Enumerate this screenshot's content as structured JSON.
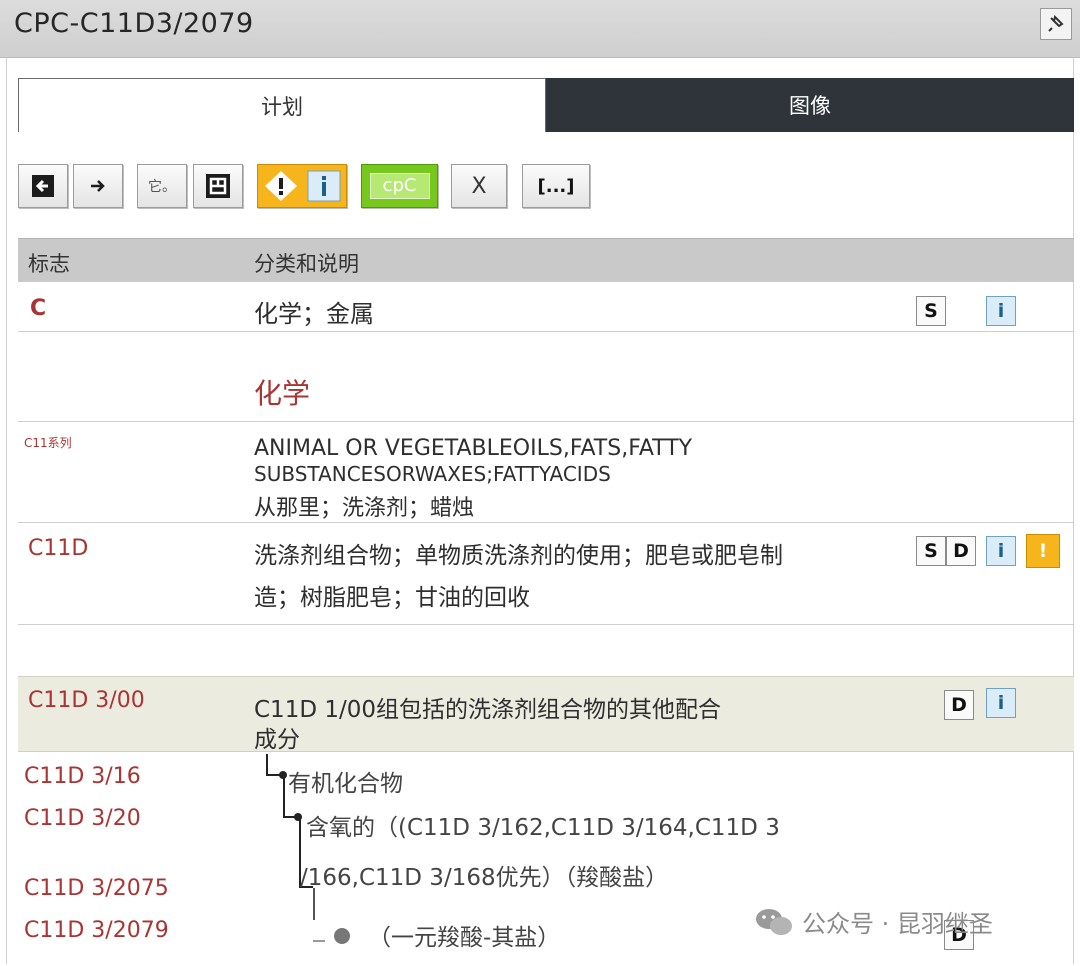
{
  "window": {
    "title": "CPC-C11D3/2079"
  },
  "tabs": [
    {
      "label": "计划"
    },
    {
      "label": "图像"
    }
  ],
  "toolbar": {
    "buttons": [
      {
        "name": "back-arrow"
      },
      {
        "name": "forward-arrow"
      },
      {
        "name": "text-button",
        "label": "它。"
      },
      {
        "name": "layout-toggle"
      },
      {
        "name": "warning-icon"
      },
      {
        "name": "info-icon"
      },
      {
        "name": "cpc-button",
        "label": "cpC"
      },
      {
        "name": "close-x-button",
        "label": "X"
      },
      {
        "name": "ellipsis-button",
        "label": "[...]"
      }
    ]
  },
  "table": {
    "headers": {
      "symbol": "标志",
      "description": "分类和说明"
    },
    "rows": [
      {
        "symbol": "C",
        "description": "化学；金属",
        "icons": [
          "S",
          "i"
        ]
      },
      {
        "symbol": "",
        "description": "化学"
      },
      {
        "symbol": "C11系列",
        "description_lines": [
          "ANIMAL OR VEGETABLEOILS,FATS,FATTY",
          "SUBSTANCESORWAXES;FATTYACIDS",
          "从那里；洗涤剂；蜡烛"
        ]
      },
      {
        "symbol": "C11D",
        "description_lines": [
          "洗涤剂组合物；单物质洗涤剂的使用；肥皂或肥皂制",
          "造；树脂肥皂；甘油的回收"
        ],
        "icons": [
          "S",
          "D",
          "i",
          "!"
        ]
      },
      {
        "symbol": "C11D 3/00",
        "description_lines": [
          "C11D 1/00组包括的洗涤剂组合物的其他配合",
          "成分"
        ],
        "icons": [
          "D",
          "i"
        ]
      },
      {
        "symbol": "C11D 3/16",
        "description": "有机化合物"
      },
      {
        "symbol": "C11D 3/20",
        "description": "含氧的（(C11D 3/162,C11D 3/164,C11D 3"
      },
      {
        "symbol": "",
        "description": "/166,C11D 3/168优先）（羧酸盐）"
      },
      {
        "symbol": "C11D 3/2075",
        "description": ""
      },
      {
        "symbol": "C11D 3/2079",
        "description": "（一元羧酸-其盐）",
        "icons": [
          "D"
        ]
      }
    ]
  },
  "watermark": {
    "text": "公众号 · 昆羽继圣"
  },
  "colors": {
    "symbol": "#a93434",
    "header_bg": "#c9c9ca",
    "highlight_row": "#ecebdf",
    "tab_dark": "#2f343b",
    "warning": "#f6b51a",
    "info": "#d9ecf7"
  }
}
